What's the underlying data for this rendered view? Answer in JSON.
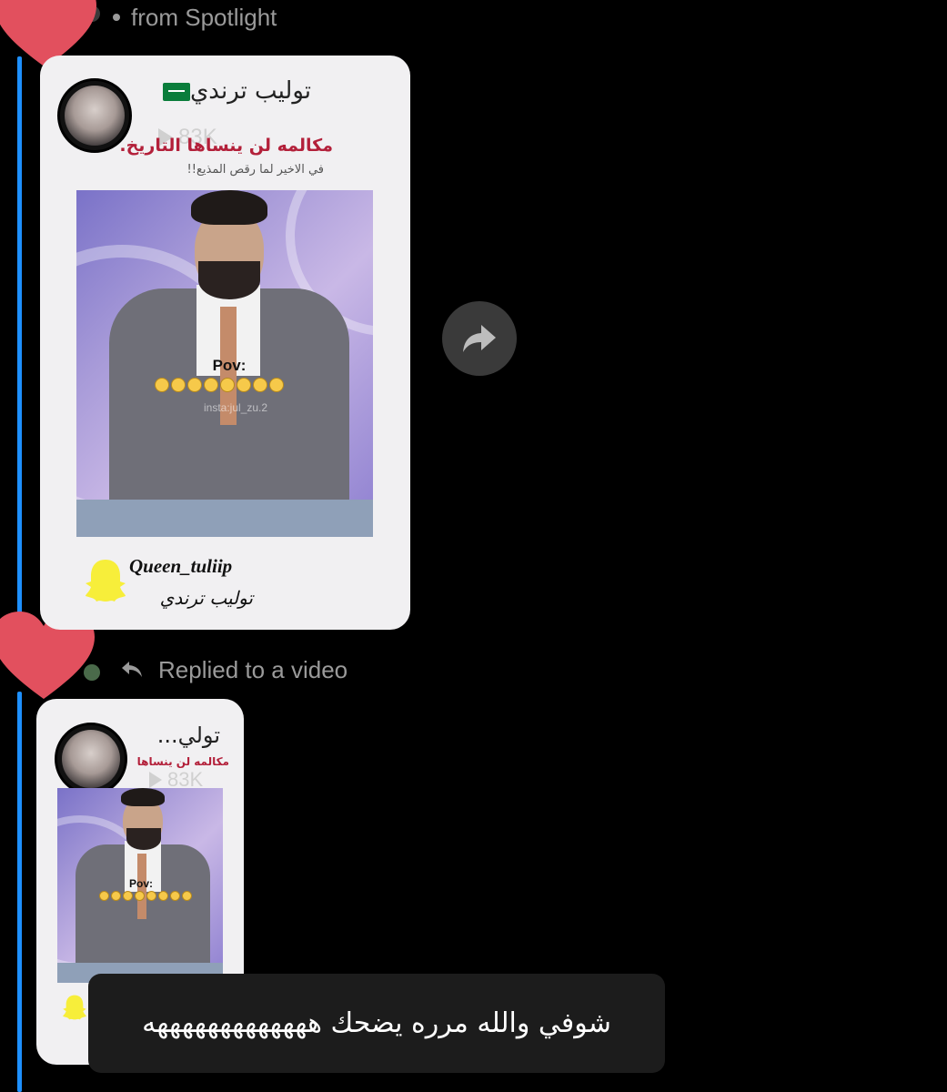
{
  "colors": {
    "thread": "#1e90ff",
    "heart": "#e2505e",
    "background": "#000000"
  },
  "spotlight_header": {
    "text": "from Spotlight"
  },
  "spotlight_card": {
    "channel_name": "توليب ترندي",
    "views": "83K",
    "headline": "مكالمه لن ينساها التاريخ.",
    "subheadline": "في الاخير لما رقص المذيع!!",
    "overlay_pov": "Pov:",
    "overlay_watermark": "insta:jul_zu.2",
    "signature_username": "Queen_tuliip",
    "signature_name": "توليب ترندي"
  },
  "reply_header": {
    "text": "Replied to a video"
  },
  "reply_card": {
    "channel_name": "تولي...",
    "views": "83K",
    "headline": "مكالمه لن ينساها",
    "overlay_pov": "Pov:"
  },
  "message": {
    "text": "شوفي والله مرره يضحك هههههههههههههه"
  },
  "icons": {
    "heart": "heart-reaction-icon",
    "share": "share-arrow-icon",
    "reply": "reply-arrow-icon",
    "play": "play-icon",
    "ghost": "snapchat-ghost-icon",
    "flag": "saudi-flag-icon"
  }
}
